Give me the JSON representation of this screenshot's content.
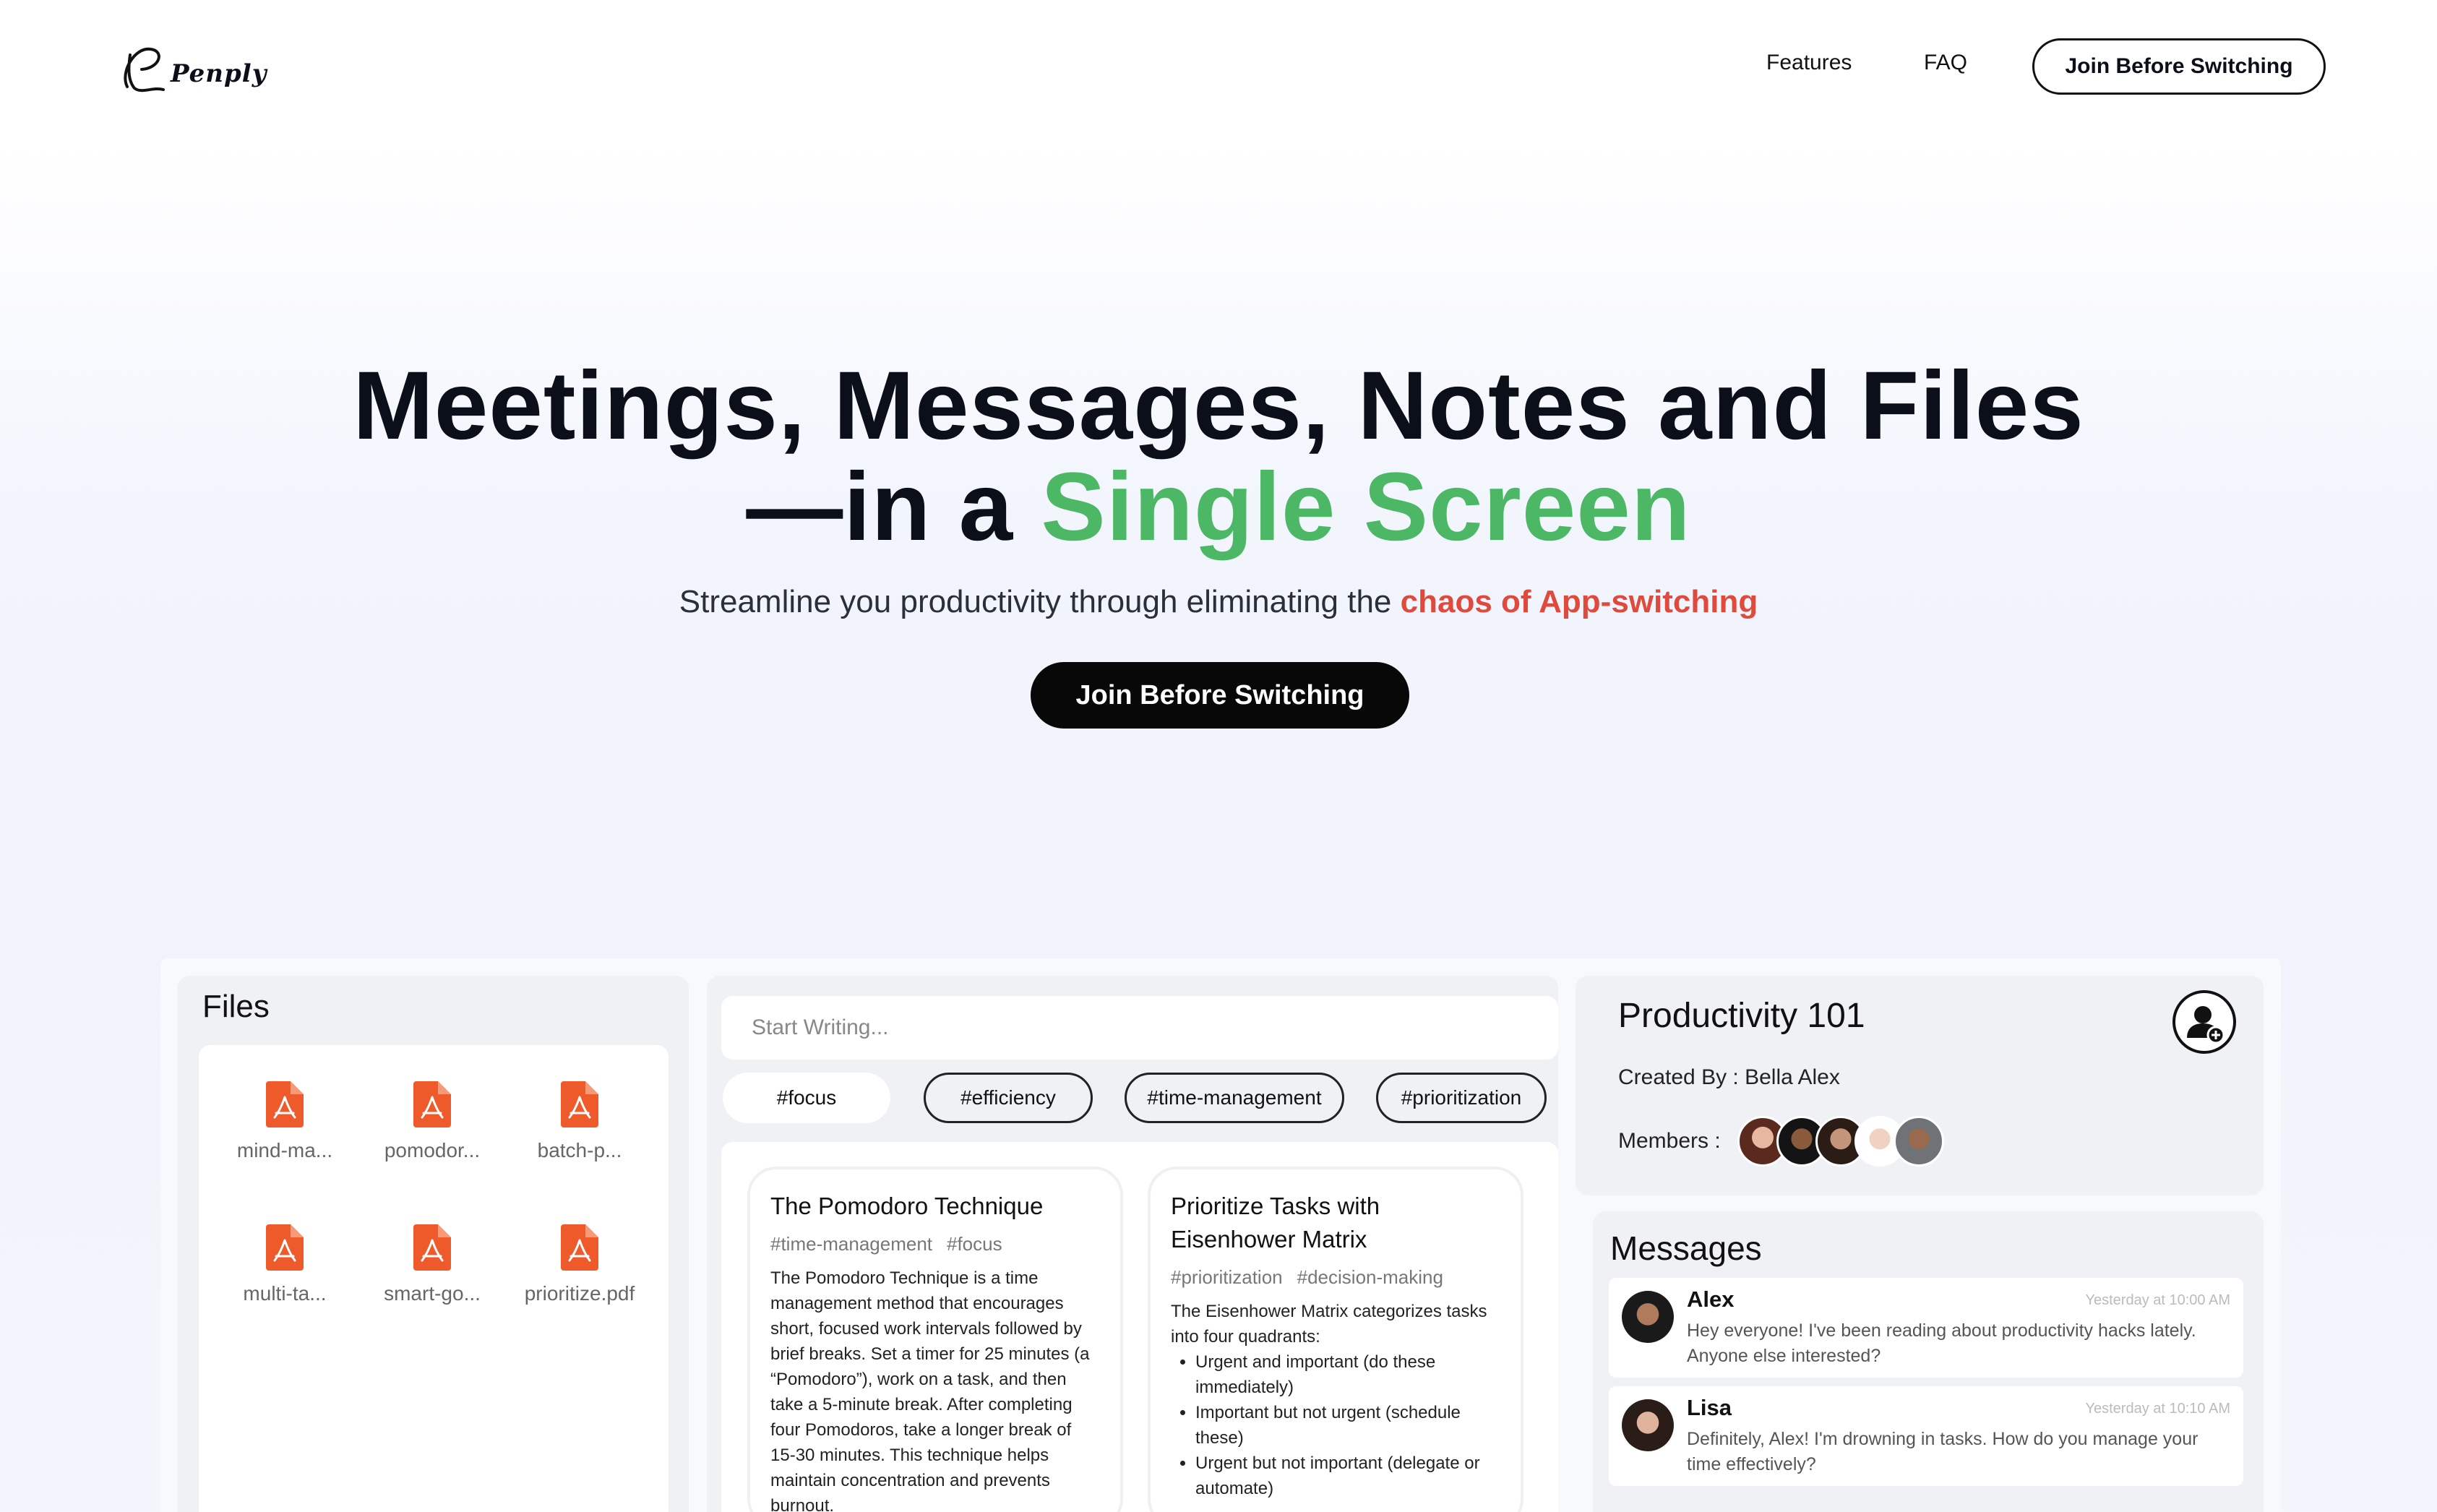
{
  "brand": {
    "name": "Penply"
  },
  "nav": {
    "links": [
      "Features",
      "FAQ"
    ],
    "cta_label": "Join Before Switching"
  },
  "hero": {
    "title_line1": "Meetings, Messages, Notes and Files",
    "title_line2_prefix": "—in a ",
    "title_line2_highlight": "Single Screen",
    "subtitle_prefix": "Streamline you productivity through eliminating the ",
    "subtitle_highlight": "chaos of App-switching",
    "cta_label": "Join Before Switching"
  },
  "colors": {
    "accent_green": "#4cb865",
    "accent_red": "#e04a3c",
    "pdf_icon": "#ef5a2b"
  },
  "files": {
    "title": "Files",
    "items": [
      {
        "name": "mind-ma...",
        "icon": "pdf-icon"
      },
      {
        "name": "pomodor...",
        "icon": "pdf-icon"
      },
      {
        "name": "batch-p...",
        "icon": "pdf-icon"
      },
      {
        "name": "multi-ta...",
        "icon": "pdf-icon"
      },
      {
        "name": "smart-go...",
        "icon": "pdf-icon"
      },
      {
        "name": "prioritize.pdf",
        "icon": "pdf-icon"
      }
    ]
  },
  "editor": {
    "placeholder": "Start Writing...",
    "tags": [
      "#focus",
      "#efficiency",
      "#time-management",
      "#prioritization"
    ]
  },
  "notes": [
    {
      "title": "The Pomodoro Technique",
      "tags": [
        "#time-management",
        "#focus"
      ],
      "body": "The Pomodoro Technique is a time management method that encourages short, focused work intervals followed by brief breaks. Set a timer for 25 minutes (a “Pomodoro”), work on a task, and then take a 5-minute break. After completing four Pomodoros, take a longer break of 15-30 minutes. This technique helps maintain concentration and prevents burnout."
    },
    {
      "title": "Prioritize Tasks with Eisenhower Matrix",
      "tags": [
        "#prioritization",
        "#decision-making"
      ],
      "body": "The Eisenhower Matrix categorizes tasks into four quadrants:",
      "bullets": [
        "Urgent and important (do these immediately)",
        "Important but not urgent (schedule these)",
        "Urgent but not important (delegate or automate)"
      ]
    }
  ],
  "group": {
    "title": "Productivity 101",
    "created_by_label": "Created By : ",
    "created_by": "Bella Alex",
    "members_label": "Members :"
  },
  "messages": {
    "title": "Messages",
    "items": [
      {
        "name": "Alex",
        "time": "Yesterday at 10:00 AM",
        "text": "Hey everyone! I've been reading about productivity hacks lately. Anyone else interested?"
      },
      {
        "name": "Lisa",
        "time": "Yesterday at 10:10 AM",
        "text": "Definitely, Alex! I'm drowning in tasks. How do you manage your time effectively?"
      }
    ]
  }
}
